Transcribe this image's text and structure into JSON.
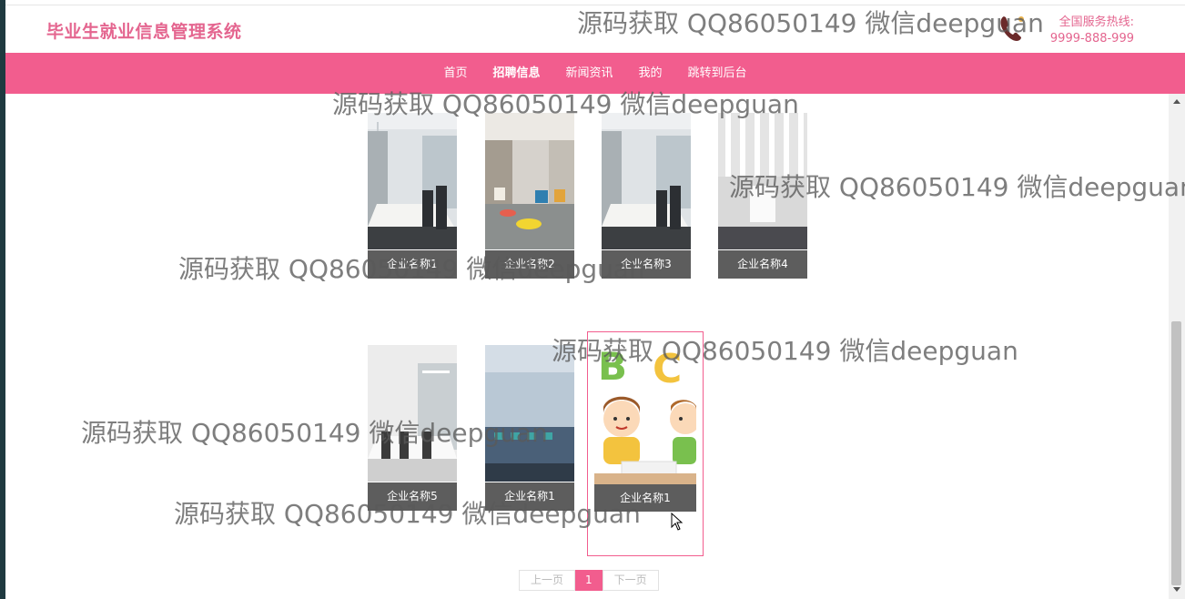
{
  "header": {
    "site_title": "毕业生就业信息管理系统",
    "hotline_label": "全国服务热线:",
    "hotline_number": "9999-888-999"
  },
  "nav": {
    "items": [
      {
        "label": "首页"
      },
      {
        "label": "招聘信息"
      },
      {
        "label": "新闻资讯"
      },
      {
        "label": "我的"
      },
      {
        "label": "跳转到后台"
      }
    ],
    "active": "招聘信息"
  },
  "companies": [
    {
      "name": "企业名称1",
      "image": "office-meeting-room"
    },
    {
      "name": "企业名称2",
      "image": "lounge-with-colorful-chairs"
    },
    {
      "name": "企业名称3",
      "image": "office-meeting-room"
    },
    {
      "name": "企业名称4",
      "image": "white-conference-hall"
    },
    {
      "name": "企业名称5",
      "image": "glass-meeting-room"
    },
    {
      "name": "企业名称1",
      "image": "open-office-workstations"
    },
    {
      "name": "企业名称1",
      "image": "cartoon-kids-abc"
    }
  ],
  "pagination": {
    "prev_label": "上一页",
    "current_page": "1",
    "next_label": "下一页"
  },
  "watermark": {
    "text": "源码获取 QQ86050149 微信deepguan"
  },
  "colors": {
    "accent": "#f25d8e",
    "title": "#e4658f",
    "caption_bg": "#5d5d5d"
  }
}
